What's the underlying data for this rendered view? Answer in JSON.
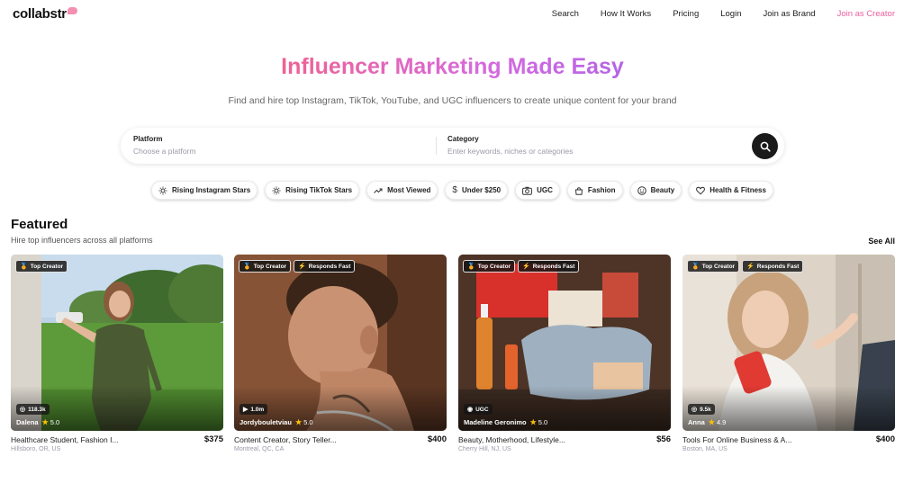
{
  "brand": {
    "logo": "collabstr",
    "accent": "#ec5fa0"
  },
  "nav": {
    "search": "Search",
    "how_it_works": "How It Works",
    "pricing": "Pricing",
    "login": "Login",
    "join_brand": "Join as Brand",
    "join_creator": "Join as Creator"
  },
  "hero": {
    "title": "Influencer Marketing Made Easy",
    "subtitle": "Find and hire top Instagram, TikTok, YouTube, and UGC influencers to create unique content for your brand"
  },
  "search": {
    "platform_label": "Platform",
    "platform_placeholder": "Choose a platform",
    "category_label": "Category",
    "category_placeholder": "Enter keywords, niches or categories",
    "button_icon": "search-icon"
  },
  "chips": [
    {
      "label": "Rising Instagram Stars",
      "icon": "sun-icon"
    },
    {
      "label": "Rising TikTok Stars",
      "icon": "sun-icon"
    },
    {
      "label": "Most Viewed",
      "icon": "trending-icon"
    },
    {
      "label": "Under $250",
      "icon": "dollar-icon"
    },
    {
      "label": "UGC",
      "icon": "camera-icon"
    },
    {
      "label": "Fashion",
      "icon": "bag-icon"
    },
    {
      "label": "Beauty",
      "icon": "smile-icon"
    },
    {
      "label": "Health & Fitness",
      "icon": "heart-icon"
    }
  ],
  "featured": {
    "title": "Featured",
    "subtitle": "Hire top influencers across all platforms",
    "see_all": "See All"
  },
  "cards": [
    {
      "badges": [
        {
          "label": "Top Creator",
          "icon": "award-icon"
        }
      ],
      "stat": "118.3k",
      "stat_icon": "instagram-icon",
      "name": "Dalena",
      "rating": "5.0",
      "description": "Healthcare Student, Fashion I...",
      "price": "$375",
      "location": "Hillsboro, OR, US"
    },
    {
      "badges": [
        {
          "label": "Top Creator",
          "icon": "award-icon"
        },
        {
          "label": "Responds Fast",
          "icon": "bolt-icon"
        }
      ],
      "stat": "1.0m",
      "stat_icon": "youtube-icon",
      "name": "Jordybouletviau",
      "rating": "5.0",
      "description": "Content Creator, Story Teller...",
      "price": "$400",
      "location": "Montreal, QC, CA"
    },
    {
      "badges": [
        {
          "label": "Top Creator",
          "icon": "award-icon"
        },
        {
          "label": "Responds Fast",
          "icon": "bolt-icon"
        }
      ],
      "stat": "UGC",
      "stat_icon": "camera-icon",
      "name": "Madeline Geronimo",
      "rating": "5.0",
      "description": "Beauty, Motherhood, Lifestyle...",
      "price": "$56",
      "location": "Cherry Hill, NJ, US"
    },
    {
      "badges": [
        {
          "label": "Top Creator",
          "icon": "award-icon"
        },
        {
          "label": "Responds Fast",
          "icon": "bolt-icon"
        }
      ],
      "stat": "9.5k",
      "stat_icon": "instagram-icon",
      "name": "Anna",
      "rating": "4.9",
      "description": "Tools For Online Business & A...",
      "price": "$400",
      "location": "Boston, MA, US"
    }
  ]
}
